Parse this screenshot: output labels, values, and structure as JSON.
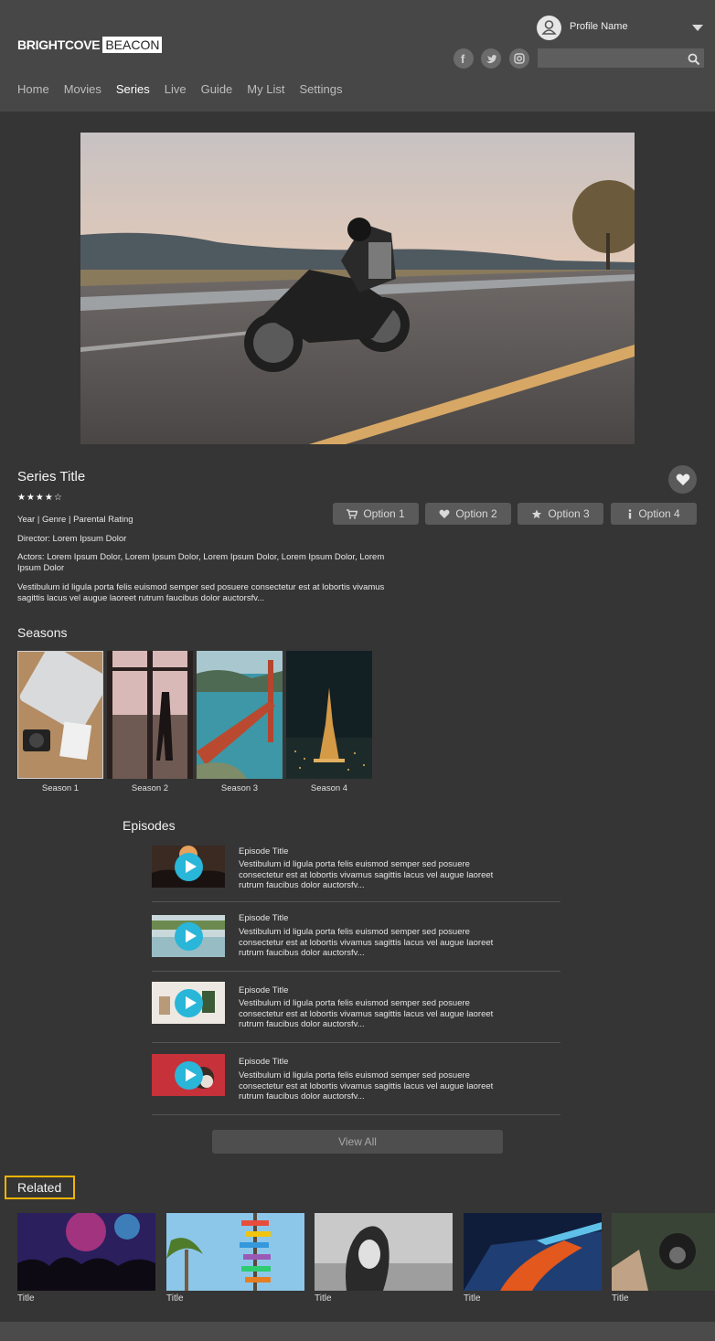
{
  "brand": {
    "name_part1": "BRIGHTCOVE",
    "name_part2": "BEACON"
  },
  "profile": {
    "name": "Profile Name"
  },
  "search": {
    "placeholder": ""
  },
  "nav": {
    "items": [
      "Home",
      "Movies",
      "Series",
      "Live",
      "Guide",
      "My List",
      "Settings"
    ],
    "active": "Series"
  },
  "series": {
    "title": "Series Title",
    "rating_stars": "★★★★☆",
    "meta": "Year | Genre | Parental Rating",
    "director": "Director: Lorem Ipsum Dolor",
    "actors": "Actors: Lorem Ipsum Dolor, Lorem Ipsum Dolor, Lorem Ipsum Dolor, Lorem Ipsum Dolor, Lorem Ipsum Dolor",
    "description": "Vestibulum id ligula porta felis euismod semper sed posuere consectetur est at lobortis vivamus sagittis lacus vel augue laoreet rutrum faucibus dolor auctorsfv..."
  },
  "options": [
    "Option 1",
    "Option 2",
    "Option 3",
    "Option 4"
  ],
  "seasons": {
    "heading": "Seasons",
    "items": [
      "Season 1",
      "Season 2",
      "Season 3",
      "Season 4"
    ]
  },
  "episodes": {
    "heading": "Episodes",
    "items": [
      {
        "title": "Episode Title",
        "description": "Vestibulum id ligula porta felis euismod semper sed posuere consectetur est at lobortis vivamus sagittis lacus vel augue laoreet rutrum faucibus dolor auctorsfv..."
      },
      {
        "title": "Episode Title",
        "description": "Vestibulum id ligula porta felis euismod semper sed posuere consectetur est at lobortis vivamus sagittis lacus vel augue laoreet rutrum faucibus dolor auctorsfv..."
      },
      {
        "title": "Episode Title",
        "description": "Vestibulum id ligula porta felis euismod semper sed posuere consectetur est at lobortis vivamus sagittis lacus vel augue laoreet rutrum faucibus dolor auctorsfv..."
      },
      {
        "title": "Episode Title",
        "description": "Vestibulum id ligula porta felis euismod semper sed posuere consectetur est at lobortis vivamus sagittis lacus vel augue laoreet rutrum faucibus dolor auctorsfv..."
      }
    ],
    "view_all_label": "View All"
  },
  "related": {
    "heading": "Related",
    "items": [
      "Title",
      "Title",
      "Title",
      "Title",
      "Title"
    ]
  },
  "colors": {
    "background": "#353535",
    "header": "#474747",
    "play_button": "#29b6d9",
    "highlight": "#f2b400"
  }
}
